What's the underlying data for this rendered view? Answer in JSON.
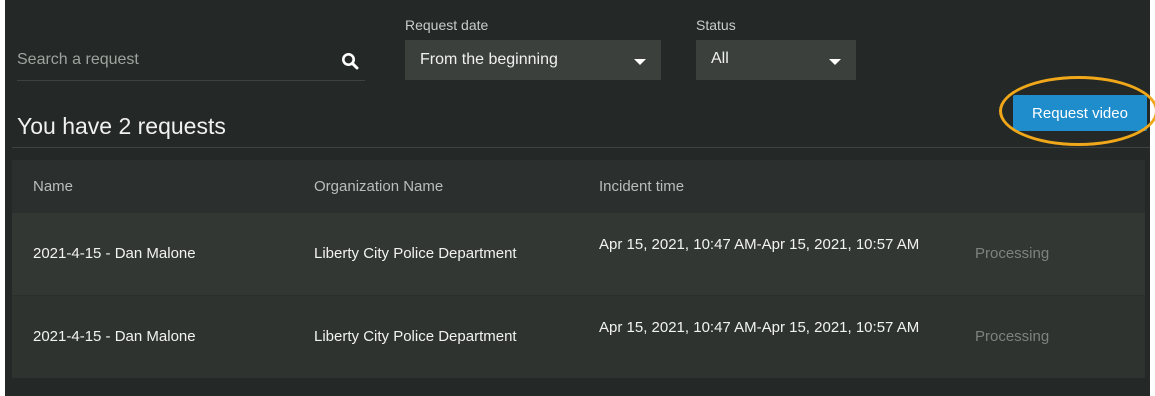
{
  "search": {
    "placeholder": "Search a request",
    "icon": "search-icon"
  },
  "filters": {
    "request_date": {
      "label": "Request date",
      "value": "From the beginning"
    },
    "status": {
      "label": "Status",
      "value": "All"
    }
  },
  "header": {
    "title": "You have 2 requests",
    "request_button_label": "Request video"
  },
  "colors": {
    "accent": "#1f8ccb",
    "highlight_ring": "#f0a81a",
    "background": "#242826"
  },
  "table": {
    "columns": [
      "Name",
      "Organization Name",
      "Incident time"
    ],
    "rows": [
      {
        "name": "2021-4-15 - Dan Malone",
        "organization": "Liberty City Police Department",
        "incident_time": "Apr 15, 2021, 10:47 AM-Apr 15, 2021, 10:57 AM",
        "status": "Processing"
      },
      {
        "name": "2021-4-15 - Dan Malone",
        "organization": "Liberty City Police Department",
        "incident_time": "Apr 15, 2021, 10:47 AM-Apr 15, 2021, 10:57 AM",
        "status": "Processing"
      }
    ]
  }
}
